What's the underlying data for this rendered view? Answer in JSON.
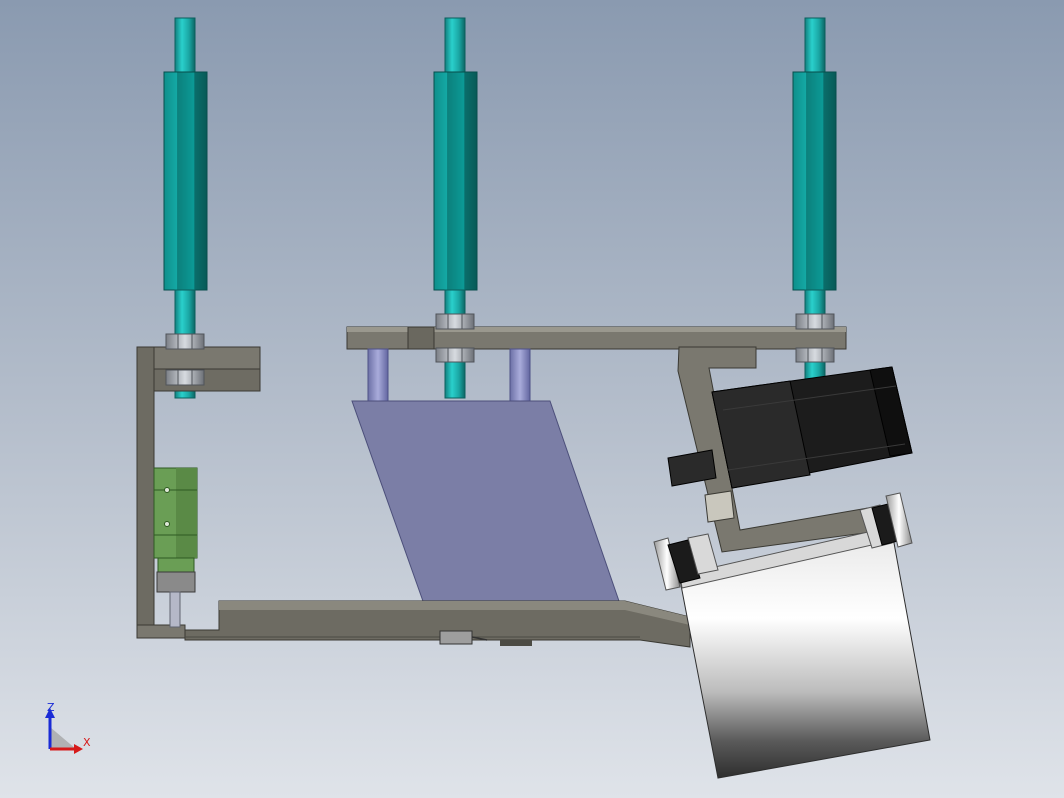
{
  "triad": {
    "z_label": "Z",
    "x_label": "X",
    "colors": {
      "z": "#1a2bd6",
      "x": "#d61a1a",
      "y_plane": "#888888"
    }
  },
  "colors": {
    "background_top": "#8a9ab0",
    "background_bottom": "#dfe3e9",
    "rod": "#22b8b5",
    "rod_dark": "#117e7c",
    "frame": "#6b6a62",
    "frame_light": "#8a887e",
    "plate": "#7b7ea8",
    "guide_rod": "#8a8dc0",
    "rail_block": "#6a9e55",
    "motor": "#1b1b1b",
    "drum_light": "#f2f2f2",
    "drum_dark": "#4a4a4a"
  }
}
